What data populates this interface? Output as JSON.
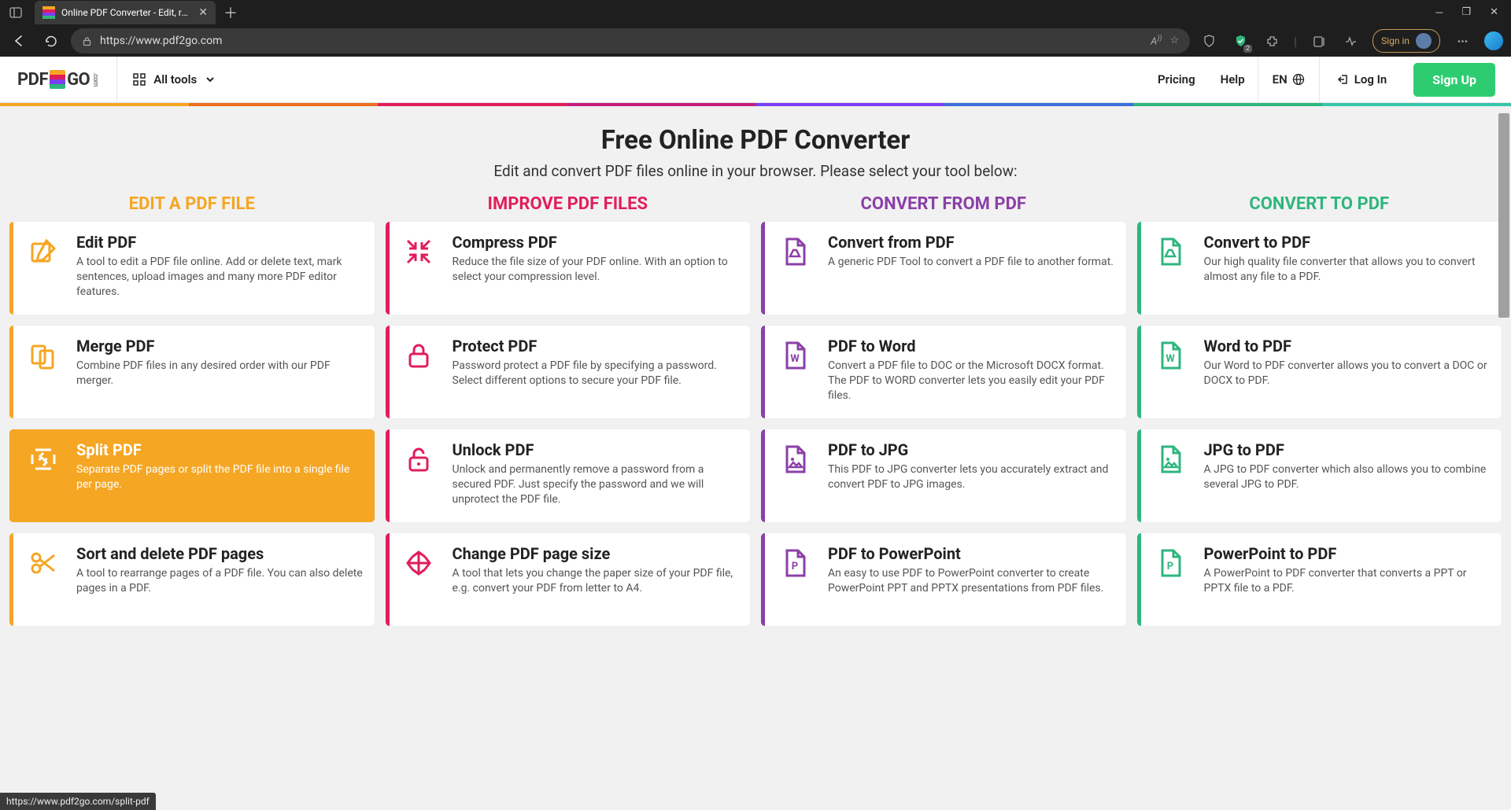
{
  "browser": {
    "tab_title": "Online PDF Converter - Edit, rota",
    "url": "https://www.pdf2go.com",
    "sign_in": "Sign in",
    "status_url": "https://www.pdf2go.com/split-pdf"
  },
  "nav": {
    "logo_pre": "PDF",
    "logo_post": "GO",
    "logo_com": ".com",
    "all_tools": "All tools",
    "pricing": "Pricing",
    "help": "Help",
    "lang": "EN",
    "login": "Log In",
    "signup": "Sign Up"
  },
  "hero": {
    "title": "Free Online PDF Converter",
    "subtitle": "Edit and convert PDF files online in your browser. Please select your tool below:"
  },
  "columns": {
    "c1": "EDIT A PDF FILE",
    "c2": "IMPROVE PDF FILES",
    "c3": "CONVERT FROM PDF",
    "c4": "CONVERT TO PDF"
  },
  "cards": {
    "c1": [
      {
        "title": "Edit PDF",
        "desc": "A tool to edit a PDF file online. Add or delete text, mark sentences, upload images and many more PDF editor features.",
        "icon": "edit-icon"
      },
      {
        "title": "Merge PDF",
        "desc": "Combine PDF files in any desired order with our PDF merger.",
        "icon": "merge-icon"
      },
      {
        "title": "Split PDF",
        "desc": "Separate PDF pages or split the PDF file into a single file per page.",
        "icon": "split-icon",
        "hover": true
      },
      {
        "title": "Sort and delete PDF pages",
        "desc": "A tool to rearrange pages of a PDF file. You can also delete pages in a PDF.",
        "icon": "scissors-icon"
      }
    ],
    "c2": [
      {
        "title": "Compress PDF",
        "desc": "Reduce the file size of your PDF online. With an option to select your compression level.",
        "icon": "compress-icon"
      },
      {
        "title": "Protect PDF",
        "desc": "Password protect a PDF file by specifying a password. Select different options to secure your PDF file.",
        "icon": "lock-icon"
      },
      {
        "title": "Unlock PDF",
        "desc": "Unlock and permanently remove a password from a secured PDF. Just specify the password and we will unprotect the PDF file.",
        "icon": "unlock-icon"
      },
      {
        "title": "Change PDF page size",
        "desc": "A tool that lets you change the paper size of your PDF file, e.g. convert your PDF from letter to A4.",
        "icon": "resize-icon"
      }
    ],
    "c3": [
      {
        "title": "Convert from PDF",
        "desc": "A generic PDF Tool to convert a PDF file to another format.",
        "icon": "pdf-icon"
      },
      {
        "title": "PDF to Word",
        "desc": "Convert a PDF file to DOC or the Microsoft DOCX format. The PDF to WORD converter lets you easily edit your PDF files.",
        "icon": "word-icon"
      },
      {
        "title": "PDF to JPG",
        "desc": "This PDF to JPG converter lets you accurately extract and convert PDF to JPG images.",
        "icon": "image-icon"
      },
      {
        "title": "PDF to PowerPoint",
        "desc": "An easy to use PDF to PowerPoint converter to create PowerPoint PPT and PPTX presentations from PDF files.",
        "icon": "ppt-icon"
      }
    ],
    "c4": [
      {
        "title": "Convert to PDF",
        "desc": "Our high quality file converter that allows you to convert almost any file to a PDF.",
        "icon": "pdf-icon"
      },
      {
        "title": "Word to PDF",
        "desc": "Our Word to PDF converter allows you to convert a DOC or DOCX to PDF.",
        "icon": "word-icon"
      },
      {
        "title": "JPG to PDF",
        "desc": "A JPG to PDF converter which also allows you to combine several JPG to PDF.",
        "icon": "image-icon"
      },
      {
        "title": "PowerPoint to PDF",
        "desc": "A PowerPoint to PDF converter that converts a PPT or PPTX file to a PDF.",
        "icon": "ppt-icon"
      }
    ]
  },
  "colors": {
    "c1": "#f5a623",
    "c2": "#e01e5a",
    "c3": "#8b3fa8",
    "c4": "#2eb67d"
  }
}
